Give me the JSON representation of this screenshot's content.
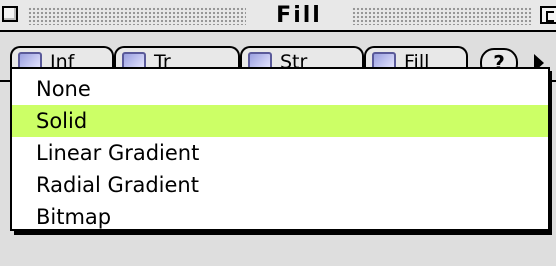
{
  "window": {
    "title": "Fill"
  },
  "tabs": [
    {
      "label": "Inf",
      "icon": "info-tab-icon"
    },
    {
      "label": "Tr",
      "icon": "transform-tab-icon"
    },
    {
      "label": "Str",
      "icon": "stroke-tab-icon"
    },
    {
      "label": "Fill",
      "icon": "fill-tab-icon"
    }
  ],
  "help": {
    "label": "?"
  },
  "menu": {
    "items": [
      {
        "label": "None",
        "selected": false
      },
      {
        "label": "Solid",
        "selected": true
      },
      {
        "label": "Linear Gradient",
        "selected": false
      },
      {
        "label": "Radial Gradient",
        "selected": false
      },
      {
        "label": "Bitmap",
        "selected": false
      }
    ]
  },
  "colors": {
    "selection_highlight": "#ccff66"
  }
}
